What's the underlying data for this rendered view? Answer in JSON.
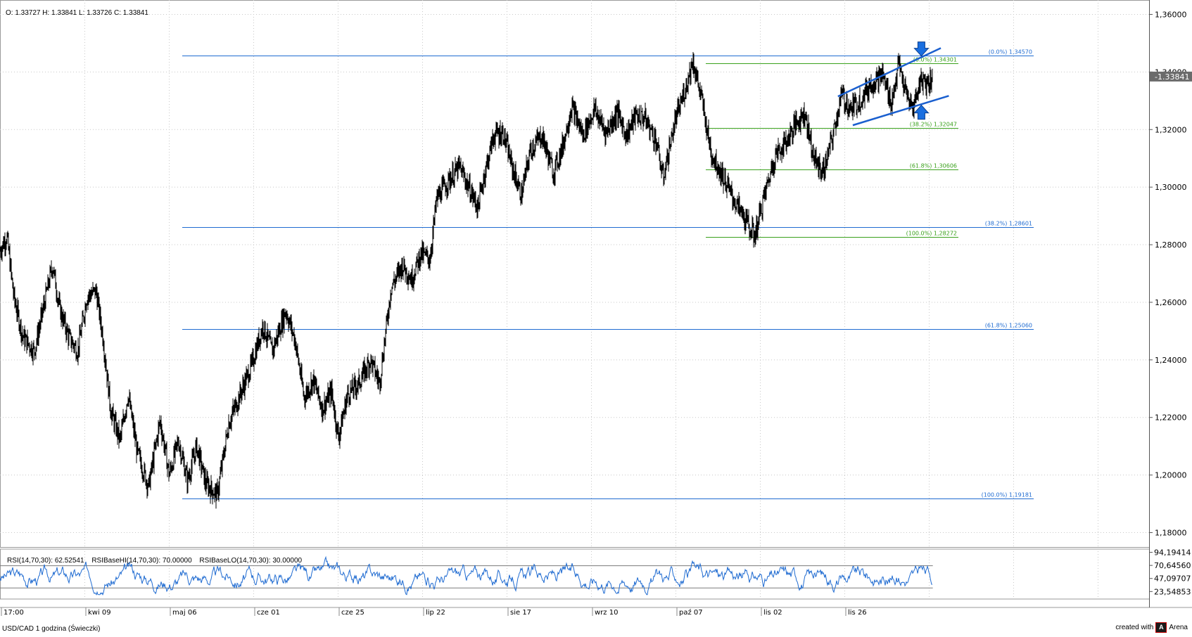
{
  "header": {
    "ohlc": "O: 1.33727 H: 1.33841 L: 1.33726 C: 1.33841"
  },
  "status_bar": {
    "instrument": "USD/CAD 1 godzina (Świeczki)",
    "created_with": "created with",
    "brand": "Arena"
  },
  "rsi_panel": {
    "labels": [
      "RSI(14,70,30): 62.52541",
      "RSIBaseHI(14,70,30): 70.00000",
      "RSIBaseLO(14,70,30): 30.00000"
    ],
    "axis_ticks": [
      "94,19414",
      "70,64560",
      "47,09707",
      "23,54853"
    ]
  },
  "colors": {
    "candles": "#000000",
    "fib_blue": "#1f6bd1",
    "fib_green": "#3aa11c",
    "channel": "#1a5fcf",
    "arrow_fill": "#1a6fe0",
    "rsi_line": "#1f6bd1",
    "grid": "#c8c8c8",
    "price_badge": "#6b6b6b"
  },
  "chart_data": {
    "type": "candlestick",
    "title": "USD/CAD 1 godzina (Świeczki)",
    "y_axis": {
      "ticks": [
        "1,36000",
        "1,34000",
        "1,32000",
        "1,30000",
        "1,28000",
        "1,26000",
        "1,24000",
        "1,22000",
        "1,20000",
        "1,18000"
      ],
      "tick_values": [
        1.36,
        1.34,
        1.32,
        1.3,
        1.28,
        1.26,
        1.24,
        1.22,
        1.2,
        1.18
      ],
      "range": [
        1.175,
        1.365
      ]
    },
    "x_axis": {
      "ticks": [
        "17:00",
        "kwi 09",
        "maj 06",
        "cze 01",
        "cze 25",
        "lip 22",
        "sie 17",
        "wrz 10",
        "paź 07",
        "lis 02",
        "lis 26"
      ]
    },
    "last_price": "1.33841",
    "price_path": [
      [
        0.0,
        1.278
      ],
      [
        0.006,
        1.283
      ],
      [
        0.012,
        1.262
      ],
      [
        0.02,
        1.248
      ],
      [
        0.03,
        1.243
      ],
      [
        0.04,
        1.262
      ],
      [
        0.046,
        1.273
      ],
      [
        0.052,
        1.258
      ],
      [
        0.06,
        1.248
      ],
      [
        0.068,
        1.243
      ],
      [
        0.076,
        1.262
      ],
      [
        0.084,
        1.264
      ],
      [
        0.09,
        1.248
      ],
      [
        0.097,
        1.222
      ],
      [
        0.105,
        1.212
      ],
      [
        0.112,
        1.228
      ],
      [
        0.12,
        1.208
      ],
      [
        0.13,
        1.196
      ],
      [
        0.14,
        1.219
      ],
      [
        0.148,
        1.2
      ],
      [
        0.156,
        1.212
      ],
      [
        0.164,
        1.198
      ],
      [
        0.172,
        1.21
      ],
      [
        0.18,
        1.197
      ],
      [
        0.19,
        1.193
      ],
      [
        0.2,
        1.218
      ],
      [
        0.21,
        1.228
      ],
      [
        0.22,
        1.238
      ],
      [
        0.23,
        1.252
      ],
      [
        0.238,
        1.243
      ],
      [
        0.25,
        1.257
      ],
      [
        0.258,
        1.247
      ],
      [
        0.266,
        1.227
      ],
      [
        0.274,
        1.233
      ],
      [
        0.282,
        1.223
      ],
      [
        0.29,
        1.229
      ],
      [
        0.296,
        1.213
      ],
      [
        0.304,
        1.228
      ],
      [
        0.314,
        1.232
      ],
      [
        0.324,
        1.24
      ],
      [
        0.332,
        1.232
      ],
      [
        0.342,
        1.265
      ],
      [
        0.352,
        1.273
      ],
      [
        0.36,
        1.268
      ],
      [
        0.368,
        1.277
      ],
      [
        0.376,
        1.275
      ],
      [
        0.382,
        1.296
      ],
      [
        0.392,
        1.302
      ],
      [
        0.402,
        1.307
      ],
      [
        0.41,
        1.3
      ],
      [
        0.418,
        1.293
      ],
      [
        0.424,
        1.305
      ],
      [
        0.432,
        1.318
      ],
      [
        0.44,
        1.319
      ],
      [
        0.448,
        1.307
      ],
      [
        0.456,
        1.297
      ],
      [
        0.464,
        1.313
      ],
      [
        0.474,
        1.318
      ],
      [
        0.484,
        1.305
      ],
      [
        0.492,
        1.314
      ],
      [
        0.5,
        1.328
      ],
      [
        0.51,
        1.318
      ],
      [
        0.52,
        1.327
      ],
      [
        0.53,
        1.319
      ],
      [
        0.54,
        1.326
      ],
      [
        0.548,
        1.318
      ],
      [
        0.556,
        1.325
      ],
      [
        0.564,
        1.324
      ],
      [
        0.574,
        1.316
      ],
      [
        0.58,
        1.303
      ],
      [
        0.59,
        1.322
      ],
      [
        0.6,
        1.335
      ],
      [
        0.606,
        1.344
      ],
      [
        0.614,
        1.33
      ],
      [
        0.622,
        1.312
      ],
      [
        0.632,
        1.304
      ],
      [
        0.64,
        1.297
      ],
      [
        0.65,
        1.29
      ],
      [
        0.66,
        1.283
      ],
      [
        0.668,
        1.296
      ],
      [
        0.678,
        1.311
      ],
      [
        0.688,
        1.316
      ],
      [
        0.696,
        1.322
      ],
      [
        0.704,
        1.326
      ],
      [
        0.712,
        1.31
      ],
      [
        0.72,
        1.305
      ],
      [
        0.728,
        1.317
      ],
      [
        0.736,
        1.332
      ],
      [
        0.744,
        1.327
      ],
      [
        0.752,
        1.33
      ],
      [
        0.762,
        1.336
      ],
      [
        0.772,
        1.339
      ],
      [
        0.78,
        1.329
      ],
      [
        0.786,
        1.343
      ],
      [
        0.792,
        1.333
      ],
      [
        0.798,
        1.327
      ],
      [
        0.806,
        1.338
      ],
      [
        0.81,
        1.336
      ],
      [
        0.816,
        1.338
      ]
    ],
    "fibonacci_blue": [
      {
        "label": "(0.0%) 1,34570",
        "value": 1.3457
      },
      {
        "label": "(38.2%) 1,28601",
        "value": 1.28601
      },
      {
        "label": "(61.8%) 1,25060",
        "value": 1.2506
      },
      {
        "label": "(100.0%) 1,19181",
        "value": 1.19181
      }
    ],
    "fibonacci_green": [
      {
        "label": "(0.0%) 1,34301",
        "value": 1.34301
      },
      {
        "label": "(38.2%) 1,32047",
        "value": 1.32047
      },
      {
        "label": "(61.8%) 1,30606",
        "value": 1.30606
      },
      {
        "label": "(100.0%) 1,28272",
        "value": 1.28272
      }
    ],
    "channel": {
      "upper": [
        [
          0.733,
          1.3315
        ],
        [
          0.823,
          1.3483
        ]
      ],
      "lower": [
        [
          0.746,
          1.3215
        ],
        [
          0.83,
          1.3317
        ]
      ]
    },
    "arrows": [
      {
        "direction": "down",
        "at": [
          0.806,
          1.3475
        ]
      },
      {
        "direction": "up",
        "at": [
          0.806,
          1.3265
        ]
      }
    ],
    "rsi": {
      "range": [
        10,
        100
      ],
      "base_hi": 70,
      "base_lo": 30,
      "last": 62.52541
    },
    "grid": true
  }
}
